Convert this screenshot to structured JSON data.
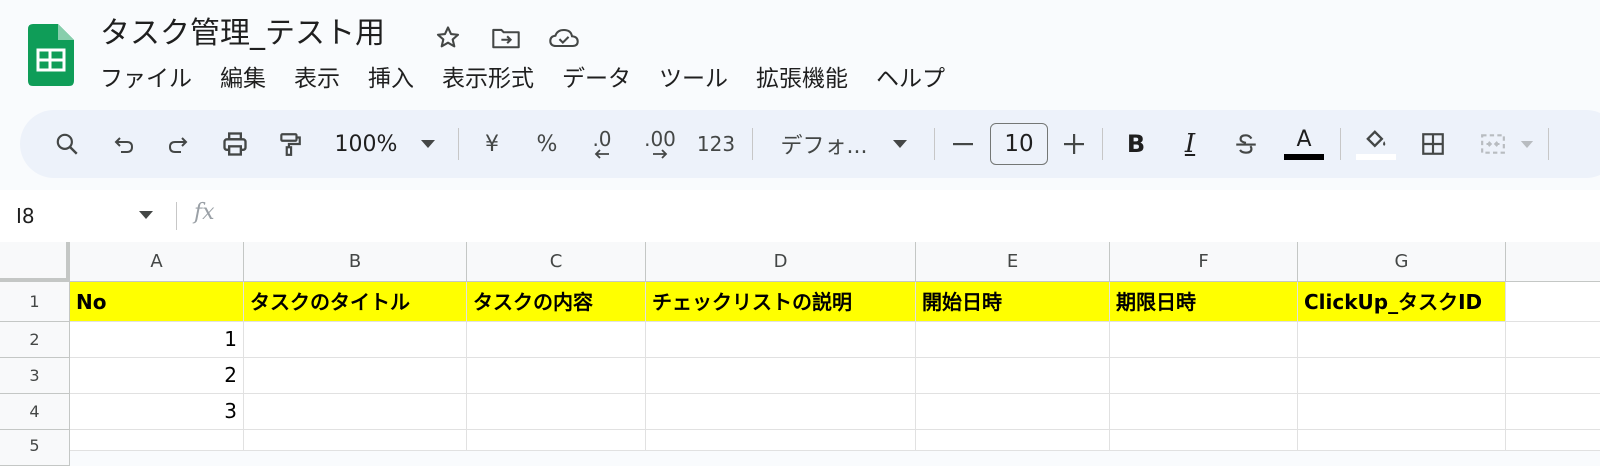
{
  "doc": {
    "title": "タスク管理_テスト用",
    "icons": [
      "star-icon",
      "move-to-folder-icon",
      "cloud-saved-icon"
    ]
  },
  "menu": [
    "ファイル",
    "編集",
    "表示",
    "挿入",
    "表示形式",
    "データ",
    "ツール",
    "拡張機能",
    "ヘルプ"
  ],
  "toolbar": {
    "zoom": "100%",
    "currency": "¥",
    "percent": "%",
    "dec_decrease": ".0",
    "dec_increase": ".00",
    "number_format": "123",
    "font": "デフォ...",
    "font_size": "10",
    "bold": "B",
    "italic": "I",
    "text_color_letter": "A",
    "text_color": "#000000"
  },
  "formula_bar": {
    "cell_ref": "I8",
    "fx": "fx",
    "value": ""
  },
  "sheet": {
    "columns": [
      "A",
      "B",
      "C",
      "D",
      "E",
      "F",
      "G"
    ],
    "rows": [
      "1",
      "2",
      "3",
      "4",
      "5"
    ],
    "header_row": [
      "No",
      "タスクのタイトル",
      "タスクの内容",
      "チェックリストの説明",
      "開始日時",
      "期限日時",
      "ClickUp_タスクID"
    ],
    "data": [
      [
        "1",
        "",
        "",
        "",
        "",
        "",
        ""
      ],
      [
        "2",
        "",
        "",
        "",
        "",
        "",
        ""
      ],
      [
        "3",
        "",
        "",
        "",
        "",
        "",
        ""
      ]
    ],
    "header_fill": "#ffff00"
  }
}
